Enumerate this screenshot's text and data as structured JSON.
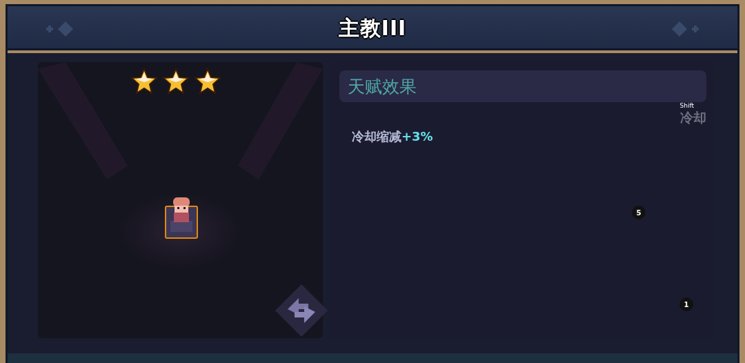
{
  "window": {
    "title": "主教III"
  },
  "hero": {
    "stars": 3
  },
  "talent": {
    "heading": "天赋效果",
    "hotkey": "Shift",
    "cooldown_label": "冷却",
    "effect": "冷却缩减**+3%**"
  },
  "badges": [
    "5",
    "1"
  ]
}
